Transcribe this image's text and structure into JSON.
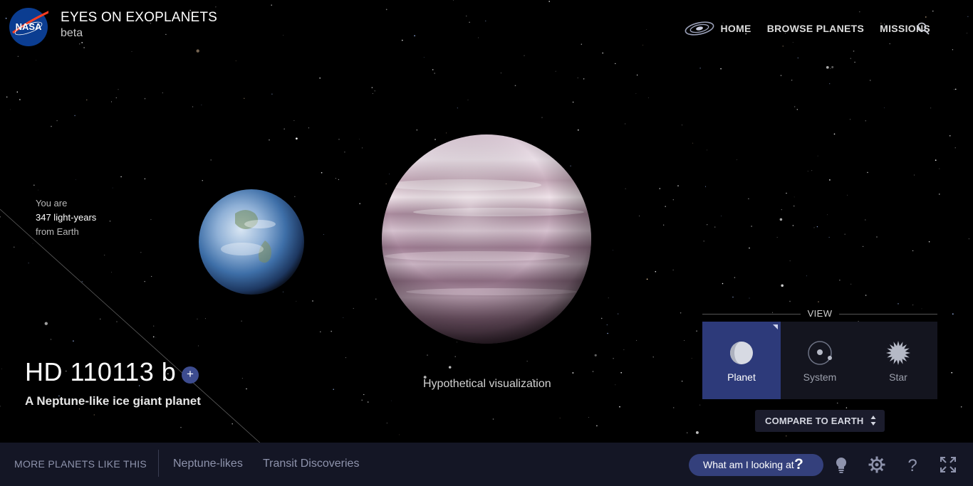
{
  "header": {
    "logo_text": "NASA",
    "title": "EYES ON EXOPLANETS",
    "subtitle": "beta",
    "nav": [
      {
        "label": "HOME"
      },
      {
        "label": "BROWSE PLANETS"
      },
      {
        "label": "MISSIONS"
      }
    ],
    "icons": [
      "nasa-logo",
      "galaxy-icon",
      "search-icon"
    ]
  },
  "distance": {
    "line1": "You are",
    "line2": "347 light-years",
    "line3": "from Earth"
  },
  "planet": {
    "name": "HD 110113 b",
    "add_label": "+",
    "description": "A Neptune-like ice giant planet"
  },
  "scene": {
    "caption": "Hypothetical visualization",
    "bodies": [
      "earth",
      "exoplanet"
    ]
  },
  "view": {
    "label": "VIEW",
    "tabs": [
      {
        "label": "Planet",
        "icon": "planet-icon",
        "active": true
      },
      {
        "label": "System",
        "icon": "system-icon",
        "active": false
      },
      {
        "label": "Star",
        "icon": "star-icon",
        "active": false
      }
    ],
    "compare_label": "COMPARE TO EARTH"
  },
  "footer": {
    "more_label": "MORE PLANETS LIKE THIS",
    "links": [
      {
        "label": "Neptune-likes"
      },
      {
        "label": "Transit Discoveries"
      }
    ],
    "ask_label": "What am I looking at",
    "ask_mark": "?",
    "icons": [
      "lightbulb-icon",
      "settings-icon",
      "help-icon",
      "fullscreen-icon"
    ]
  },
  "colors": {
    "background": "#000000",
    "accent": "#2d3a7a",
    "footer_bg": "#141625",
    "panel_bg": "#14151f"
  }
}
